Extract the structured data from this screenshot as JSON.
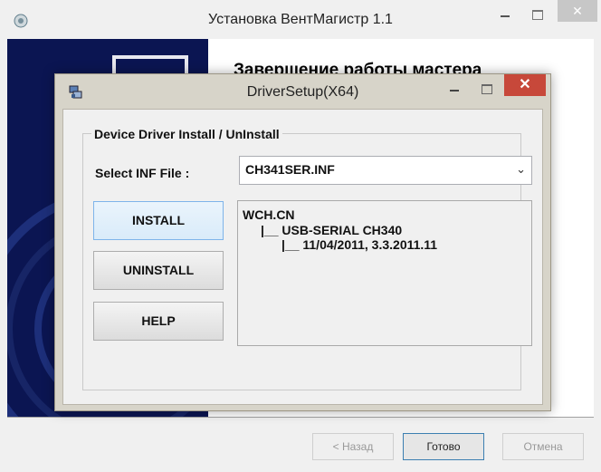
{
  "installer_window": {
    "title": "Установка ВентМагистр 1.1",
    "heading": "Завершение работы мастера",
    "buttons": {
      "back": "< Назад",
      "finish": "Готово",
      "cancel": "Отмена"
    },
    "close_glyph": "✕",
    "icon": "installer-icon"
  },
  "driver_dialog": {
    "title": "DriverSetup(X64)",
    "close_glyph": "✕",
    "icon": "driver-setup-icon",
    "group_title": "Device Driver Install / UnInstall",
    "inf_label": "Select INF File :",
    "inf_value": "CH341SER.INF",
    "dropdown_glyph": "⌄",
    "buttons": {
      "install": "INSTALL",
      "uninstall": "UNINSTALL",
      "help": "HELP"
    },
    "info": {
      "line1": "WCH.CN",
      "line2": "|__ USB-SERIAL CH340",
      "line3": "|__ 11/04/2011, 3.3.2011.11"
    }
  },
  "colors": {
    "banner_blue": "#0b1552",
    "close_red": "#c7483a",
    "dialog_frame": "#d7d4c9"
  }
}
